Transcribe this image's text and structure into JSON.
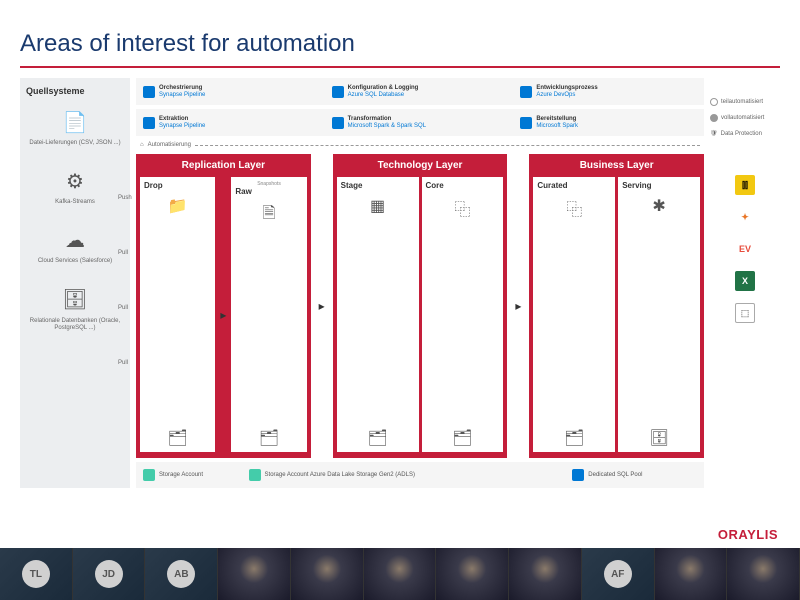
{
  "title": "Areas of interest for automation",
  "brand": "ORAYLIS",
  "sources": {
    "heading": "Quellsysteme",
    "items": [
      {
        "label": "Datei-Lieferungen\n(CSV, JSON ...)",
        "mode": "Push"
      },
      {
        "label": "Kafka-Streams",
        "mode": "Pull"
      },
      {
        "label": "Cloud Services (Salesforce)",
        "mode": "Pull"
      },
      {
        "label": "Relationale Datenbanken\n(Oracle, PostgreSQL ...)",
        "mode": "Pull"
      }
    ]
  },
  "top_services": {
    "row1": [
      {
        "title": "Orchestrierung",
        "sub": "Synapse Pipeline"
      },
      {
        "title": "Konfiguration & Logging",
        "sub": "Azure SQL Database"
      },
      {
        "title": "Entwicklungsprozess",
        "sub": "Azure DevOps"
      }
    ],
    "row2": [
      {
        "title": "Extraktion",
        "sub": "Synapse Pipeline"
      },
      {
        "title": "Transformation",
        "sub": "Microsoft Spark & Spark SQL"
      },
      {
        "title": "Bereitstellung",
        "sub": "Microsoft Spark"
      }
    ]
  },
  "automation_label": "Automatisierung",
  "layers": [
    {
      "name": "Replication Layer",
      "zones": [
        "Drop",
        "Raw"
      ],
      "snapshots_label": "Snapshots"
    },
    {
      "name": "Technology Layer",
      "zones": [
        "Stage",
        "Core"
      ]
    },
    {
      "name": "Business Layer",
      "zones": [
        "Curated",
        "Serving"
      ]
    }
  ],
  "storage": [
    {
      "label": "Storage\nAccount"
    },
    {
      "label": "Storage Account\nAzure Data Lake Storage Gen2 (ADLS)"
    },
    {
      "label": "Dedicated\nSQL Pool"
    }
  ],
  "legend": {
    "teil": "teilautomatisiert",
    "voll": "vollautomatisiert",
    "dp": "Data Protection"
  },
  "tools": [
    "Power BI",
    "Tableau",
    "EV",
    "Excel",
    "Cube"
  ],
  "participants": [
    "TL",
    "JD",
    "AB",
    "",
    "",
    "",
    "",
    "",
    "AF",
    "",
    ""
  ]
}
